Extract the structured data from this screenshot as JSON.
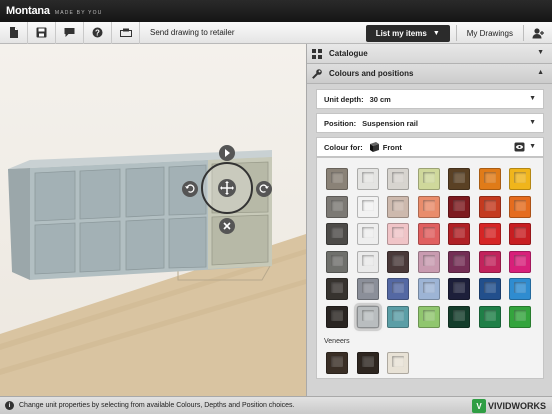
{
  "app": {
    "brand": "Montana",
    "tagline": "MADE BY YOU"
  },
  "toolbar": {
    "icons": [
      "new-file-icon",
      "save-icon",
      "comment-icon",
      "help-icon",
      "print-icon"
    ],
    "send_label": "Send drawing to retailer",
    "list_label": "List my items",
    "my_drawings_label": "My Drawings"
  },
  "panel": {
    "catalogue_label": "Catalogue",
    "colours_label": "Colours and positions",
    "unit_depth": {
      "label": "Unit depth:",
      "value": "30 cm"
    },
    "position": {
      "label": "Position:",
      "value": "Suspension rail"
    },
    "colour_for": {
      "label": "Colour for:",
      "value": "Front"
    },
    "swatch_rows": [
      [
        "#8a8277",
        "#e4e4e2",
        "#d7d4cf",
        "#cfd89b",
        "#5a4124",
        "#e07b18",
        "#f0b51b"
      ],
      [
        "#7c7974",
        "#f2f2f2",
        "#cdb9ad",
        "#e98c6b",
        "#7d1a1f",
        "#c43a1f",
        "#e56c1e"
      ],
      [
        "#4d4b48",
        "#eeeeee",
        "#f0c4c7",
        "#e05f5f",
        "#b02025",
        "#d62525",
        "#c81e22"
      ],
      [
        "#6f706c",
        "#eaeaea",
        "#4a3a3a",
        "#c99bb0",
        "#742e55",
        "#c2235c",
        "#d8207a"
      ],
      [
        "#37332f",
        "#8b8f99",
        "#5468a3",
        "#9db4d5",
        "#1d1f3a",
        "#224f8c",
        "#2f8cd0"
      ],
      [
        "#2a2522",
        "#b9bdbf",
        "#5b9ea6",
        "#90c66e",
        "#143d2b",
        "#1f7f47",
        "#34a43d"
      ]
    ],
    "selected_swatch": [
      5,
      1
    ],
    "veneers_label": "Veneers",
    "veneers": [
      "#3a2f26",
      "#2e2620",
      "#e8e2d6"
    ]
  },
  "status": {
    "text": "Change unit properties by selecting from available Colours, Depths and Position choices.",
    "logo_prefix": "V",
    "logo_text": "VIVIDWORKS"
  }
}
